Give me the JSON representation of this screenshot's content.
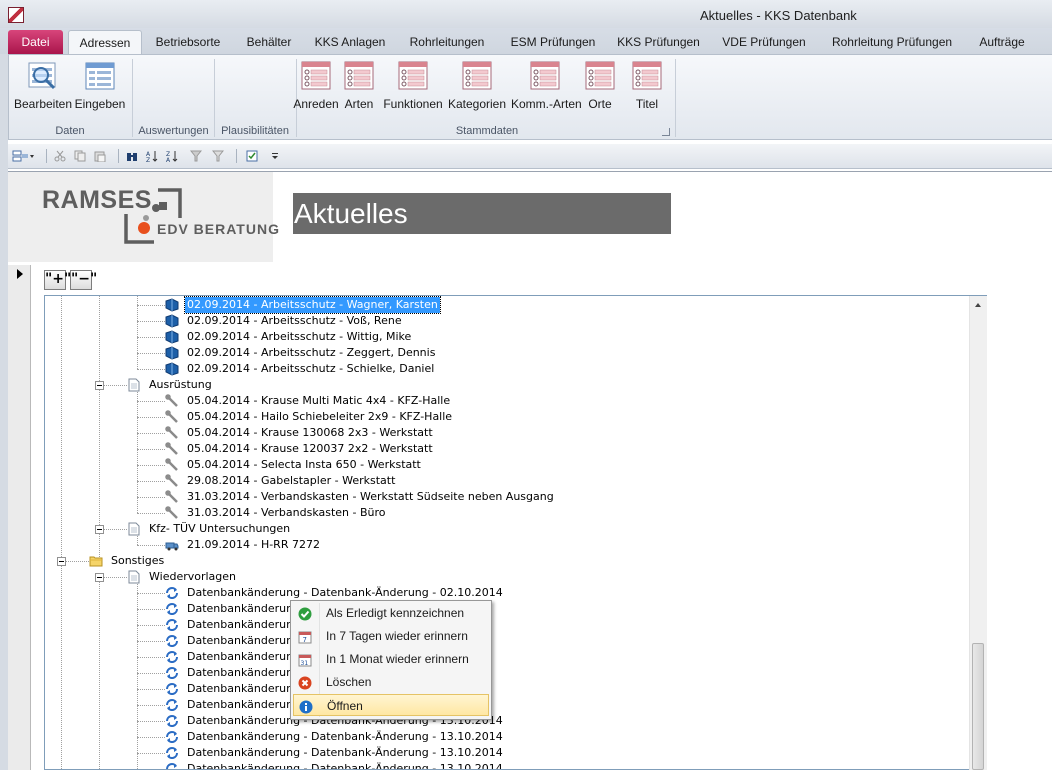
{
  "window": {
    "title": "Aktuelles  -  KKS Datenbank"
  },
  "tabs": [
    "Datei",
    "Adressen",
    "Betriebsorte",
    "Behälter",
    "KKS Anlagen",
    "Rohrleitungen",
    "ESM Prüfungen",
    "KKS Prüfungen",
    "VDE Prüfungen",
    "Rohrleitung Prüfungen",
    "Aufträge"
  ],
  "ribbon": {
    "daten": {
      "label": "Daten",
      "buttons": [
        "Bearbeiten",
        "Eingeben"
      ]
    },
    "auswertungen": {
      "label": "Auswertungen"
    },
    "plausibilitaeten": {
      "label": "Plausibilitäten"
    },
    "stammdaten": {
      "label": "Stammdaten",
      "buttons": [
        "Anreden",
        "Arten",
        "Funktionen",
        "Kategorien",
        "Komm.-Arten",
        "Orte",
        "Titel"
      ]
    }
  },
  "header": {
    "logo_main": "RAMSES",
    "logo_sub": "EDV BERATUNG",
    "title": "Aktuelles"
  },
  "tree_controls": {
    "expand": "\"+\"",
    "collapse": "\"−\""
  },
  "tree": [
    {
      "level": 3,
      "icon": "book-icon",
      "text": "02.09.2014 - Arbeitsschutz - Wagner, Karsten",
      "selected": true
    },
    {
      "level": 3,
      "icon": "book-icon",
      "text": "02.09.2014 - Arbeitsschutz - Voß, Rene"
    },
    {
      "level": 3,
      "icon": "book-icon",
      "text": "02.09.2014 - Arbeitsschutz - Wittig, Mike"
    },
    {
      "level": 3,
      "icon": "book-icon",
      "text": "02.09.2014 - Arbeitsschutz - Zeggert, Dennis"
    },
    {
      "level": 3,
      "icon": "book-icon",
      "text": "02.09.2014 - Arbeitsschutz - Schielke, Daniel"
    },
    {
      "level": 2,
      "icon": "document-icon",
      "text": "Ausrüstung",
      "expanded": true
    },
    {
      "level": 3,
      "icon": "wrench-icon",
      "text": "05.04.2014 - Krause Multi Matic 4x4 - KFZ-Halle"
    },
    {
      "level": 3,
      "icon": "wrench-icon",
      "text": "05.04.2014 - Hailo Schiebeleiter 2x9 - KFZ-Halle"
    },
    {
      "level": 3,
      "icon": "wrench-icon",
      "text": "05.04.2014 - Krause 130068 2x3 - Werkstatt"
    },
    {
      "level": 3,
      "icon": "wrench-icon",
      "text": "05.04.2014 - Krause 120037 2x2 - Werkstatt"
    },
    {
      "level": 3,
      "icon": "wrench-icon",
      "text": "05.04.2014 - Selecta Insta 650 - Werkstatt"
    },
    {
      "level": 3,
      "icon": "wrench-icon",
      "text": "29.08.2014 - Gabelstapler - Werkstatt"
    },
    {
      "level": 3,
      "icon": "wrench-icon",
      "text": "31.03.2014 - Verbandskasten - Werkstatt Südseite neben Ausgang"
    },
    {
      "level": 3,
      "icon": "wrench-icon",
      "text": "31.03.2014 - Verbandskasten - Büro"
    },
    {
      "level": 2,
      "icon": "document-icon",
      "text": "Kfz- TÜV Untersuchungen",
      "expanded": true
    },
    {
      "level": 3,
      "icon": "truck-icon",
      "text": "21.09.2014 - H-RR 7272"
    },
    {
      "level": 1,
      "icon": "folder-icon",
      "text": "Sonstiges",
      "expanded": true
    },
    {
      "level": 2,
      "icon": "document-icon",
      "text": "Wiedervorlagen",
      "expanded": true
    },
    {
      "level": 3,
      "icon": "refresh-icon",
      "text": "Datenbankänderung - Datenbank-Änderung - 02.10.2014"
    },
    {
      "level": 3,
      "icon": "refresh-icon",
      "text": "Datenbankänderung - D"
    },
    {
      "level": 3,
      "icon": "refresh-icon",
      "text": "Datenbankänderung - D"
    },
    {
      "level": 3,
      "icon": "refresh-icon",
      "text": "Datenbankänderung - D"
    },
    {
      "level": 3,
      "icon": "refresh-icon",
      "text": "Datenbankänderung - D"
    },
    {
      "level": 3,
      "icon": "refresh-icon",
      "text": "Datenbankänderung - D"
    },
    {
      "level": 3,
      "icon": "refresh-icon",
      "text": "Datenbankänderung - D"
    },
    {
      "level": 3,
      "icon": "refresh-icon",
      "text": "Datenbankänderung - D"
    },
    {
      "level": 3,
      "icon": "refresh-icon",
      "text": "Datenbankänderung - Datenbank-Änderung - 13.10.2014"
    },
    {
      "level": 3,
      "icon": "refresh-icon",
      "text": "Datenbankänderung - Datenbank-Änderung - 13.10.2014"
    },
    {
      "level": 3,
      "icon": "refresh-icon",
      "text": "Datenbankänderung - Datenbank-Änderung - 13.10.2014"
    },
    {
      "level": 3,
      "icon": "refresh-icon",
      "text": "Datenbankänderung - Datenbank-Änderung - 13.10.2014"
    }
  ],
  "context_menu": [
    {
      "label": "Als Erledigt kennzeichnen",
      "icon": "check-circle-icon"
    },
    {
      "label": "In 7 Tagen wieder erinnern",
      "icon": "calendar-7-icon"
    },
    {
      "label": "In 1 Monat wieder erinnern",
      "icon": "calendar-31-icon"
    },
    {
      "label": "Löschen",
      "icon": "delete-circle-icon"
    },
    {
      "label": "Öffnen",
      "icon": "info-circle-icon",
      "highlighted": true
    }
  ],
  "colors": {
    "accent_file_tab": "#c0245a",
    "selection": "#3399ff",
    "title_box": "#6b6b6b",
    "logo_dot": "#e8501e"
  }
}
